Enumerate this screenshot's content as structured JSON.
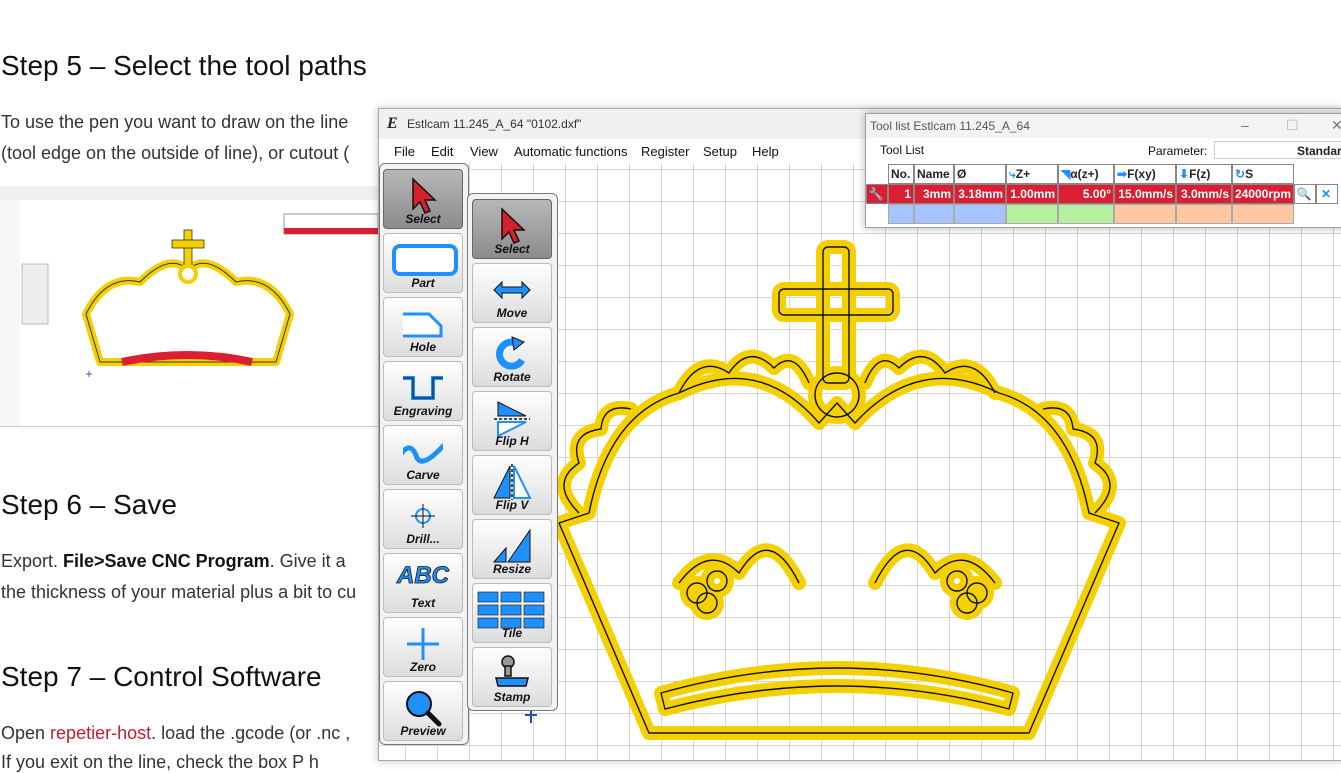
{
  "article": {
    "step5_heading": "Step 5 – Select the tool paths",
    "step5_line1": "To use the pen you want to draw on the line",
    "step5_line2": "(tool edge on the outside of line), or cutout (",
    "step6_heading": "Step 6 – Save",
    "step6_line1_pre": "Export. ",
    "step6_line1_bold": "File>Save CNC Program",
    "step6_line1_post": ". Give it a",
    "step6_line2": "the thickness of your material plus a bit to cu",
    "step7_heading": "Step 7 – Control Software",
    "step7_line1_pre": "Open ",
    "step7_line1_link": "repetier-host",
    "step7_line1_post": ". load the .gcode (or .nc ,",
    "step7_line2": "If you exit on the line, check the box P h"
  },
  "main_window": {
    "title": "Estlcam 11.245_A_64 \"0102.dxf\"",
    "app_icon_glyph": "E",
    "menu": [
      "File",
      "Edit",
      "View",
      "Automatic functions",
      "Register",
      "Setup",
      "Help"
    ]
  },
  "left_toolbar": [
    {
      "label": "Select",
      "icon": "pointer-icon",
      "active": true
    },
    {
      "label": "Part",
      "icon": "part-icon"
    },
    {
      "label": "Hole",
      "icon": "hole-icon"
    },
    {
      "label": "Engraving",
      "icon": "engraving-icon"
    },
    {
      "label": "Carve",
      "icon": "carve-icon"
    },
    {
      "label": "Drill...",
      "icon": "drill-icon"
    },
    {
      "label": "Text",
      "icon": "text-icon",
      "glyph": "ABC"
    },
    {
      "label": "Zero",
      "icon": "zero-icon"
    },
    {
      "label": "Preview",
      "icon": "preview-icon"
    }
  ],
  "right_toolbar": [
    {
      "label": "Select",
      "icon": "pointer-icon",
      "active": true
    },
    {
      "label": "Move",
      "icon": "move-icon"
    },
    {
      "label": "Rotate",
      "icon": "rotate-icon"
    },
    {
      "label": "Flip H",
      "icon": "flip-h-icon"
    },
    {
      "label": "Flip V",
      "icon": "flip-v-icon"
    },
    {
      "label": "Resize",
      "icon": "resize-icon"
    },
    {
      "label": "Tile",
      "icon": "tile-icon"
    },
    {
      "label": "Stamp",
      "icon": "stamp-icon"
    }
  ],
  "tool_list": {
    "title": "Tool list Estlcam 11.245_A_64",
    "tab": "Tool List",
    "param_label": "Parameter:",
    "param_value": "Standard",
    "headers": [
      "No.",
      "Name",
      "Ø",
      "Z+",
      "α(z+)",
      "F(xy)",
      "F(z)",
      "S"
    ],
    "row": [
      "1",
      "3mm",
      "3.18mm",
      "1.00mm",
      "5.00°",
      "15.0mm/s",
      "3.0mm/s",
      "24000rpm"
    ]
  },
  "colors": {
    "crown_fill": "#f5d000",
    "crown_outline": "#111111",
    "tool_row": "#dc1e32",
    "accent_blue": "#1e90ff",
    "icon_red": "#d8202c"
  }
}
